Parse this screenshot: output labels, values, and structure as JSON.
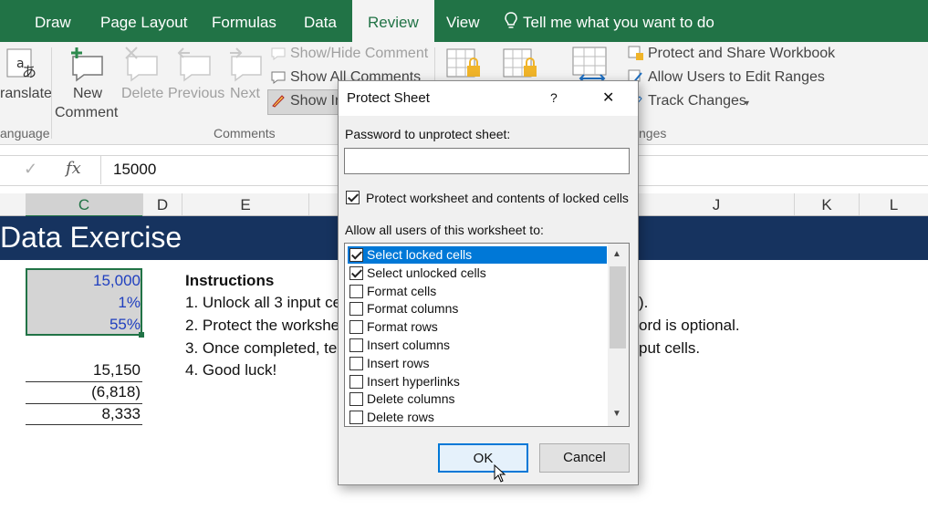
{
  "ribbon": {
    "tabs": [
      "Draw",
      "Page Layout",
      "Formulas",
      "Data",
      "Review",
      "View"
    ],
    "tell_me": "Tell me what you want to do",
    "translate_label": "ranslate",
    "language_group": "anguage",
    "new_comment_1": "New",
    "new_comment_2": "Comment",
    "delete_label": "Delete",
    "previous_label": "Previous",
    "next_label": "Next",
    "show_hide_comment": "Show/Hide Comment",
    "show_all_comments": "Show All Comments",
    "show_ink_partial": "Show In",
    "comments_group": "Comments",
    "protect_share": "Protect and Share Workbook",
    "allow_users": "Allow Users to Edit Ranges",
    "track_changes": "Track Changes",
    "changes_group": "nges"
  },
  "formula_bar": {
    "fx": "fx",
    "value": "15000"
  },
  "columns": [
    "C",
    "D",
    "E",
    "J",
    "K",
    "L"
  ],
  "sheet": {
    "banner": "Data Exercise",
    "inputs": [
      "15,000",
      "1%",
      "55%"
    ],
    "outputs": [
      "15,150",
      "(6,818)",
      "8,333"
    ],
    "instructions_title": "Instructions",
    "instr_1": "1. Unlock all 3 input cells",
    "instr_2": "2. Protect the workshee",
    "instr_3": "3. Once completed, test",
    "instr_4": "4. Good luck!",
    "instr_1_tail": ").",
    "instr_2_tail": "ord is optional.",
    "instr_3_tail": "put cells."
  },
  "dialog": {
    "title": "Protect Sheet",
    "help": "?",
    "close": "✕",
    "password_label": "Password to unprotect sheet:",
    "password_value": "",
    "protect_contents_label": "Protect worksheet and contents of locked cells",
    "allow_label": "Allow all users of this worksheet to:",
    "permissions": [
      {
        "label": "Select locked cells",
        "checked": true,
        "selected": true
      },
      {
        "label": "Select unlocked cells",
        "checked": true,
        "selected": false
      },
      {
        "label": "Format cells",
        "checked": false,
        "selected": false
      },
      {
        "label": "Format columns",
        "checked": false,
        "selected": false
      },
      {
        "label": "Format rows",
        "checked": false,
        "selected": false
      },
      {
        "label": "Insert columns",
        "checked": false,
        "selected": false
      },
      {
        "label": "Insert rows",
        "checked": false,
        "selected": false
      },
      {
        "label": "Insert hyperlinks",
        "checked": false,
        "selected": false
      },
      {
        "label": "Delete columns",
        "checked": false,
        "selected": false
      },
      {
        "label": "Delete rows",
        "checked": false,
        "selected": false
      }
    ],
    "ok": "OK",
    "cancel": "Cancel"
  },
  "colors": {
    "excel_green": "#217346",
    "banner_navy": "#16335f",
    "input_blue": "#1f3fbf",
    "selection_blue": "#0078d7"
  }
}
